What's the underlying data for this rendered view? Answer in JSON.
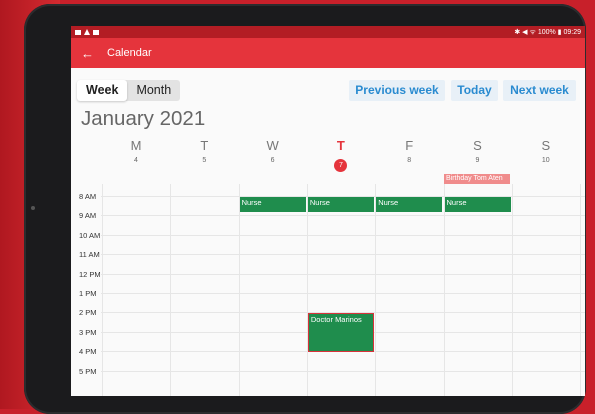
{
  "status": {
    "right": "✱ ◀ ᯤ 100% ▮ 09:29"
  },
  "appbar": {
    "title": "Calendar"
  },
  "view": {
    "week": "Week",
    "month": "Month"
  },
  "nav": {
    "previous": "Previous week",
    "today": "Today",
    "next": "Next week"
  },
  "month_title": "January 2021",
  "days": [
    {
      "letter": "M",
      "num": "4"
    },
    {
      "letter": "T",
      "num": "5"
    },
    {
      "letter": "W",
      "num": "6"
    },
    {
      "letter": "T",
      "num": "7",
      "today": true
    },
    {
      "letter": "F",
      "num": "8"
    },
    {
      "letter": "S",
      "num": "9"
    },
    {
      "letter": "S",
      "num": "10"
    }
  ],
  "allday_event": "Birthday Tom Aten",
  "hours": [
    "8 AM",
    "9 AM",
    "10 AM",
    "11 AM",
    "12 PM",
    "1 PM",
    "2 PM",
    "3 PM",
    "4 PM",
    "5 PM"
  ],
  "events": [
    {
      "title": "Nurse",
      "day": 2,
      "start": 8.0,
      "end": 8.75
    },
    {
      "title": "Nurse",
      "day": 3,
      "start": 8.0,
      "end": 8.75
    },
    {
      "title": "Nurse",
      "day": 4,
      "start": 8.0,
      "end": 8.75
    },
    {
      "title": "Nurse",
      "day": 5,
      "start": 8.0,
      "end": 8.75
    },
    {
      "title": "Doctor Marinos",
      "day": 3,
      "start": 14.0,
      "end": 16.0,
      "selected": true
    }
  ],
  "colors": {
    "primary": "#e5343c",
    "status": "#b31d24",
    "event": "#1f8d4d",
    "allday": "#f08c8c",
    "link": "#2a8bd0"
  }
}
